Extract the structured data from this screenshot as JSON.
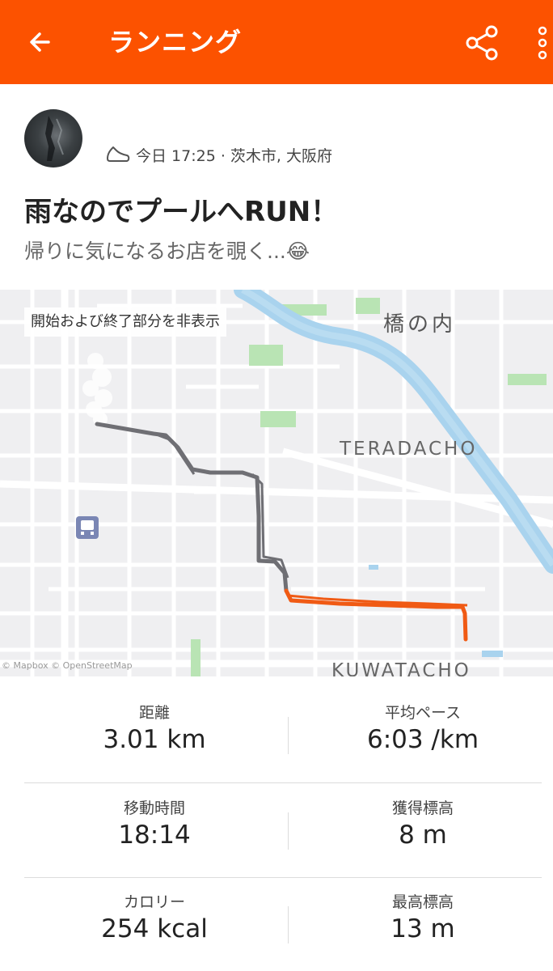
{
  "colors": {
    "accent": "#fc5200",
    "route_gray": "#6f6f74",
    "route_orange": "#f05a14",
    "river": "#a9d3ee"
  },
  "appbar": {
    "title": "ランニング",
    "icons": [
      "back-arrow-icon",
      "share-icon",
      "more-vertical-icon"
    ]
  },
  "activity": {
    "meta_text": "今日 17:25 · 茨木市, 大阪府",
    "title": "雨なのでプールへRUN！",
    "description": "帰りに気になるお店を覗く...😂"
  },
  "map": {
    "badge": "開始および終了部分を非表示",
    "labels": {
      "hashi": "橋の内",
      "teradacho": "TERADACHO",
      "kuwatacho": "KUWATACHO"
    },
    "attribution": "© Mapbox © OpenStreetMap"
  },
  "stats": [
    {
      "left_label": "距離",
      "left_value": "3.01 km",
      "right_label": "平均ペース",
      "right_value": "6:03 /km"
    },
    {
      "left_label": "移動時間",
      "left_value": "18:14",
      "right_label": "獲得標高",
      "right_value": "8 m"
    },
    {
      "left_label": "カロリー",
      "left_value": "254 kcal",
      "right_label": "最高標高",
      "right_value": "13 m"
    }
  ]
}
